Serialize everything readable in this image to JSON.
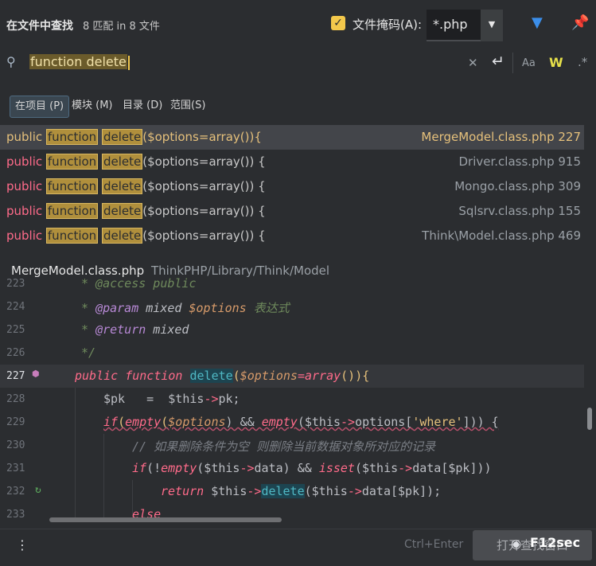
{
  "header": {
    "title": "在文件中查找",
    "match_summary": "8 匹配 in 8 文件",
    "file_mask_label": "文件掩码(A):",
    "file_mask_value": "*.php",
    "file_mask_checked": true
  },
  "search": {
    "query": "function delete"
  },
  "scopes": [
    {
      "label": "在项目 (P)",
      "active": true
    },
    {
      "label": "模块 (M)",
      "active": false
    },
    {
      "label": "目录 (D)",
      "active": false
    },
    {
      "label": "范围(S)",
      "active": false
    }
  ],
  "results": [
    {
      "kw": "public ",
      "m1": "function",
      "m2": "delete",
      "rest": "($options=array()){",
      "file": "MergeModel.class.php 227",
      "selected": true
    },
    {
      "kw": "public ",
      "m1": "function",
      "m2": "delete",
      "rest": "($options=array()) {",
      "file": "Driver.class.php 915",
      "selected": false
    },
    {
      "kw": "public ",
      "m1": "function",
      "m2": "delete",
      "rest": "($options=array()) {",
      "file": "Mongo.class.php 309",
      "selected": false
    },
    {
      "kw": "public ",
      "m1": "function",
      "m2": "delete",
      "rest": "($options=array()) {",
      "file": "Sqlsrv.class.php 155",
      "selected": false
    },
    {
      "kw": "public ",
      "m1": "function",
      "m2": "delete",
      "rest": "($options=array()) {",
      "file": "Think\\Model.class.php 469",
      "selected": false
    }
  ],
  "preview": {
    "file_name": "MergeModel.class.php",
    "file_path": "ThinkPHP/Library/Think/Model",
    "line_numbers": [
      "223",
      "224",
      "225",
      "226",
      "227",
      "228",
      "229",
      "230",
      "231",
      "232",
      "233"
    ],
    "l223": "* @access public",
    "l224_a": "* ",
    "l224_tag": "@param",
    "l224_b": " mixed ",
    "l224_var": "$options",
    "l224_c": " 表达式",
    "l225_a": "* ",
    "l225_tag": "@return",
    "l225_b": " mixed",
    "l226": "*/",
    "l227_kw1": "public",
    "l227_kw2": "function",
    "l227_fn": "delete",
    "l227_open": "(",
    "l227_var": "$options",
    "l227_eq": "=",
    "l227_arr": "array",
    "l227_rest": "()){",
    "l228_a": "$pk   =  $this",
    "l228_arrow": "->",
    "l228_b": "pk;",
    "l229_if": "if",
    "l229_a": "(",
    "l229_empty": "empty",
    "l229_b": "(",
    "l229_var": "$options",
    "l229_c": ") && ",
    "l229_empty2": "empty",
    "l229_d": "($this",
    "l229_arrow": "->",
    "l229_e": "options[",
    "l229_str": "'where'",
    "l229_f": "])) {",
    "l230": "// 如果删除条件为空 则删除当前数据对象所对应的记录",
    "l231_if": "if",
    "l231_a": "(!",
    "l231_empty": "empty",
    "l231_b": "($this",
    "l231_arrow": "->",
    "l231_c": "data) && ",
    "l231_isset": "isset",
    "l231_d": "($this",
    "l231_arrow2": "->",
    "l231_e": "data[$pk]))",
    "l232_ret": "return",
    "l232_a": " $this",
    "l232_arrow": "->",
    "l232_fn": "delete",
    "l232_b": "($this",
    "l232_arrow2": "->",
    "l232_c": "data[$pk]);",
    "l233": "else"
  },
  "footer": {
    "shortcut": "Ctrl+Enter",
    "open_button": "打开查找窗口",
    "watermark": "F12sec"
  }
}
